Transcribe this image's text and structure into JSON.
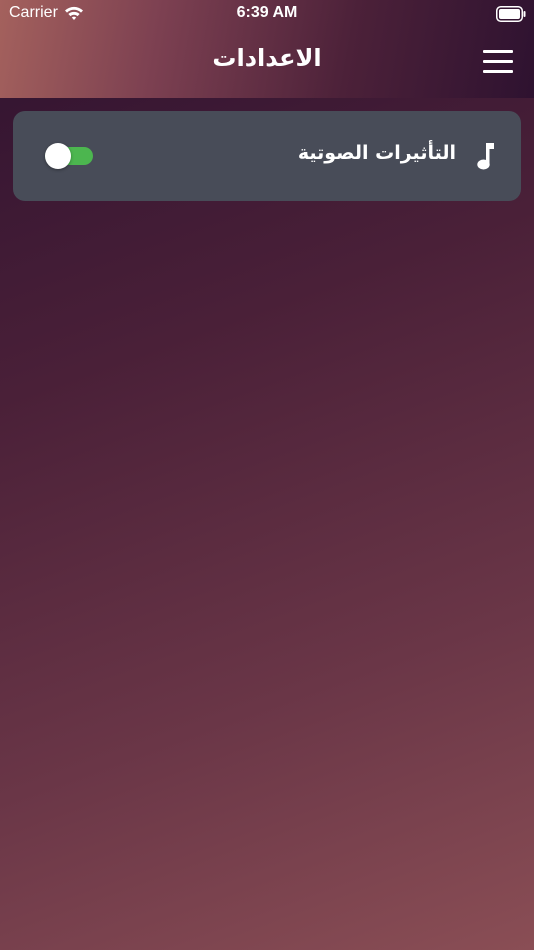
{
  "status_bar": {
    "carrier": "Carrier",
    "time": "6:39 AM",
    "wifi_icon": "wifi-icon",
    "battery_icon": "battery-icon"
  },
  "header": {
    "title": "الاعدادات",
    "menu_icon": "hamburger-menu-icon"
  },
  "settings": {
    "items": [
      {
        "label": "التأثيرات الصوتية",
        "icon": "music-note-icon",
        "toggle_on": true,
        "toggle_color": "#4cb64f"
      }
    ]
  },
  "colors": {
    "card_background": "#484c58",
    "header_gradient_start": "#a4615d",
    "header_gradient_end": "#2e1230",
    "background_top": "#2f1230",
    "background_bottom": "#8a4e55"
  }
}
